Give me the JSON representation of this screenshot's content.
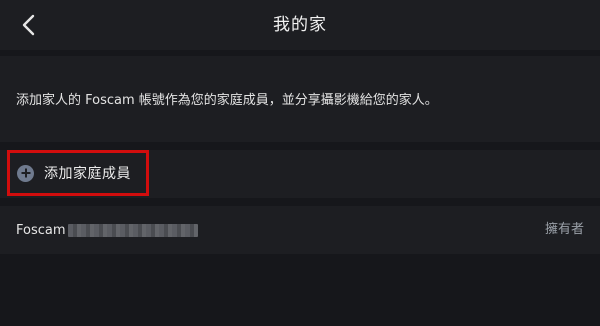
{
  "header": {
    "title": "我的家",
    "back_icon": "chevron-left-icon"
  },
  "description": {
    "text": "添加家人的 Foscam 帳號作為您的家庭成員，並分享攝影機給您的家人。"
  },
  "add_member": {
    "icon": "plus-circle-icon",
    "label": "添加家庭成員",
    "highlight_color": "#d10d0d"
  },
  "members": [
    {
      "name_visible": "Foscam",
      "name_obscured": true,
      "role": "擁有者"
    }
  ],
  "colors": {
    "background": "#16171b",
    "panel": "#1d1e22",
    "text": "#e6e6e6",
    "muted": "#9aa0a8",
    "icon": "#6f7a8e"
  }
}
